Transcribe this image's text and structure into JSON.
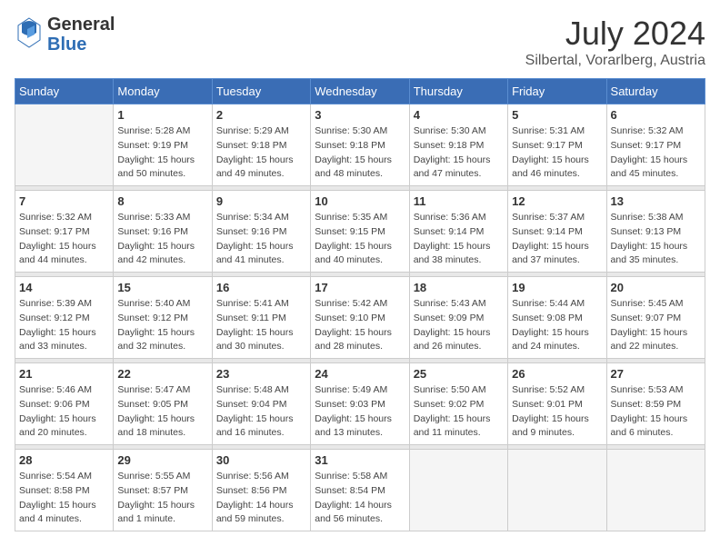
{
  "header": {
    "logo_general": "General",
    "logo_blue": "Blue",
    "month_year": "July 2024",
    "location": "Silbertal, Vorarlberg, Austria"
  },
  "weekdays": [
    "Sunday",
    "Monday",
    "Tuesday",
    "Wednesday",
    "Thursday",
    "Friday",
    "Saturday"
  ],
  "weeks": [
    {
      "days": [
        {
          "num": "",
          "info": ""
        },
        {
          "num": "1",
          "info": "Sunrise: 5:28 AM\nSunset: 9:19 PM\nDaylight: 15 hours\nand 50 minutes."
        },
        {
          "num": "2",
          "info": "Sunrise: 5:29 AM\nSunset: 9:18 PM\nDaylight: 15 hours\nand 49 minutes."
        },
        {
          "num": "3",
          "info": "Sunrise: 5:30 AM\nSunset: 9:18 PM\nDaylight: 15 hours\nand 48 minutes."
        },
        {
          "num": "4",
          "info": "Sunrise: 5:30 AM\nSunset: 9:18 PM\nDaylight: 15 hours\nand 47 minutes."
        },
        {
          "num": "5",
          "info": "Sunrise: 5:31 AM\nSunset: 9:17 PM\nDaylight: 15 hours\nand 46 minutes."
        },
        {
          "num": "6",
          "info": "Sunrise: 5:32 AM\nSunset: 9:17 PM\nDaylight: 15 hours\nand 45 minutes."
        }
      ]
    },
    {
      "days": [
        {
          "num": "7",
          "info": "Sunrise: 5:32 AM\nSunset: 9:17 PM\nDaylight: 15 hours\nand 44 minutes."
        },
        {
          "num": "8",
          "info": "Sunrise: 5:33 AM\nSunset: 9:16 PM\nDaylight: 15 hours\nand 42 minutes."
        },
        {
          "num": "9",
          "info": "Sunrise: 5:34 AM\nSunset: 9:16 PM\nDaylight: 15 hours\nand 41 minutes."
        },
        {
          "num": "10",
          "info": "Sunrise: 5:35 AM\nSunset: 9:15 PM\nDaylight: 15 hours\nand 40 minutes."
        },
        {
          "num": "11",
          "info": "Sunrise: 5:36 AM\nSunset: 9:14 PM\nDaylight: 15 hours\nand 38 minutes."
        },
        {
          "num": "12",
          "info": "Sunrise: 5:37 AM\nSunset: 9:14 PM\nDaylight: 15 hours\nand 37 minutes."
        },
        {
          "num": "13",
          "info": "Sunrise: 5:38 AM\nSunset: 9:13 PM\nDaylight: 15 hours\nand 35 minutes."
        }
      ]
    },
    {
      "days": [
        {
          "num": "14",
          "info": "Sunrise: 5:39 AM\nSunset: 9:12 PM\nDaylight: 15 hours\nand 33 minutes."
        },
        {
          "num": "15",
          "info": "Sunrise: 5:40 AM\nSunset: 9:12 PM\nDaylight: 15 hours\nand 32 minutes."
        },
        {
          "num": "16",
          "info": "Sunrise: 5:41 AM\nSunset: 9:11 PM\nDaylight: 15 hours\nand 30 minutes."
        },
        {
          "num": "17",
          "info": "Sunrise: 5:42 AM\nSunset: 9:10 PM\nDaylight: 15 hours\nand 28 minutes."
        },
        {
          "num": "18",
          "info": "Sunrise: 5:43 AM\nSunset: 9:09 PM\nDaylight: 15 hours\nand 26 minutes."
        },
        {
          "num": "19",
          "info": "Sunrise: 5:44 AM\nSunset: 9:08 PM\nDaylight: 15 hours\nand 24 minutes."
        },
        {
          "num": "20",
          "info": "Sunrise: 5:45 AM\nSunset: 9:07 PM\nDaylight: 15 hours\nand 22 minutes."
        }
      ]
    },
    {
      "days": [
        {
          "num": "21",
          "info": "Sunrise: 5:46 AM\nSunset: 9:06 PM\nDaylight: 15 hours\nand 20 minutes."
        },
        {
          "num": "22",
          "info": "Sunrise: 5:47 AM\nSunset: 9:05 PM\nDaylight: 15 hours\nand 18 minutes."
        },
        {
          "num": "23",
          "info": "Sunrise: 5:48 AM\nSunset: 9:04 PM\nDaylight: 15 hours\nand 16 minutes."
        },
        {
          "num": "24",
          "info": "Sunrise: 5:49 AM\nSunset: 9:03 PM\nDaylight: 15 hours\nand 13 minutes."
        },
        {
          "num": "25",
          "info": "Sunrise: 5:50 AM\nSunset: 9:02 PM\nDaylight: 15 hours\nand 11 minutes."
        },
        {
          "num": "26",
          "info": "Sunrise: 5:52 AM\nSunset: 9:01 PM\nDaylight: 15 hours\nand 9 minutes."
        },
        {
          "num": "27",
          "info": "Sunrise: 5:53 AM\nSunset: 8:59 PM\nDaylight: 15 hours\nand 6 minutes."
        }
      ]
    },
    {
      "days": [
        {
          "num": "28",
          "info": "Sunrise: 5:54 AM\nSunset: 8:58 PM\nDaylight: 15 hours\nand 4 minutes."
        },
        {
          "num": "29",
          "info": "Sunrise: 5:55 AM\nSunset: 8:57 PM\nDaylight: 15 hours\nand 1 minute."
        },
        {
          "num": "30",
          "info": "Sunrise: 5:56 AM\nSunset: 8:56 PM\nDaylight: 14 hours\nand 59 minutes."
        },
        {
          "num": "31",
          "info": "Sunrise: 5:58 AM\nSunset: 8:54 PM\nDaylight: 14 hours\nand 56 minutes."
        },
        {
          "num": "",
          "info": ""
        },
        {
          "num": "",
          "info": ""
        },
        {
          "num": "",
          "info": ""
        }
      ]
    }
  ]
}
